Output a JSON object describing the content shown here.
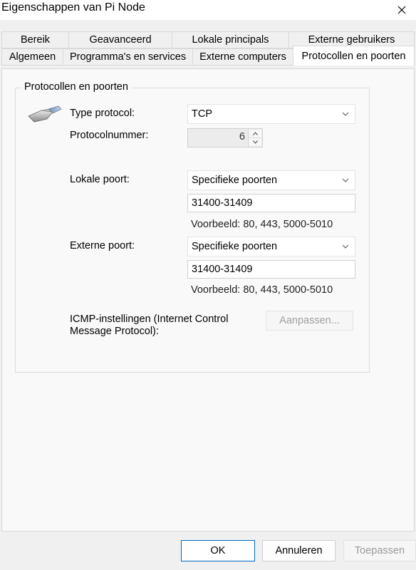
{
  "window": {
    "title": "Eigenschappen van Pi Node"
  },
  "tabs": {
    "row1": [
      "Bereik",
      "Geavanceerd",
      "Lokale principals",
      "Externe gebruikers"
    ],
    "row2": [
      "Algemeen",
      "Programma's en services",
      "Externe computers",
      "Protocollen en poorten"
    ],
    "active": "Protocollen en poorten"
  },
  "group": {
    "title": "Protocollen en poorten",
    "protocol_type_label": "Type protocol:",
    "protocol_type_value": "TCP",
    "protocol_number_label": "Protocolnummer:",
    "protocol_number_value": "6",
    "local_port_label": "Lokale poort:",
    "local_port_mode": "Specifieke poorten",
    "local_port_value": "31400-31409",
    "local_port_example": "Voorbeeld: 80, 443, 5000-5010",
    "remote_port_label": "Externe poort:",
    "remote_port_mode": "Specifieke poorten",
    "remote_port_value": "31400-31409",
    "remote_port_example": "Voorbeeld: 80, 443, 5000-5010",
    "icmp_label_line1": "ICMP-instellingen (Internet Control",
    "icmp_label_line2": "Message Protocol):",
    "icmp_button": "Aanpassen..."
  },
  "footer": {
    "ok": "OK",
    "cancel": "Annuleren",
    "apply": "Toepassen"
  },
  "icons": [
    "close-icon",
    "network-plug-icon",
    "chevron-down-icon",
    "spin-up-icon",
    "spin-down-icon"
  ]
}
